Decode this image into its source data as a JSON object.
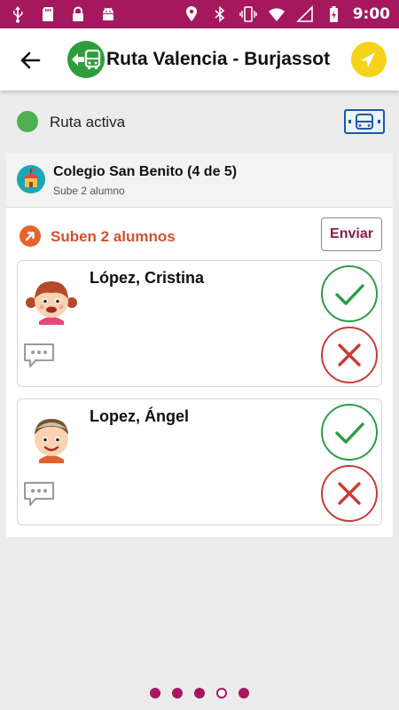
{
  "status_bar": {
    "time": "9:00",
    "color": "#a5185e",
    "left_icons": [
      "usb-icon",
      "sd-card-icon",
      "lock-icon",
      "android-icon"
    ],
    "right_icons": [
      "location-icon",
      "bluetooth-icon",
      "vibrate-icon",
      "wifi-icon",
      "signal-icon",
      "battery-charging-icon"
    ]
  },
  "app_bar": {
    "title": "Ruta Valencia - Burjassot",
    "back_icon": "arrow-back-icon",
    "logo_icon": "bus-route-icon",
    "action_icon": "navigation-icon",
    "logo_color": "#2e9e3a",
    "action_color": "#f6d31b"
  },
  "route_status": {
    "label": "Ruta activa",
    "indicator_color": "#4caf50",
    "card_icon": "bus-card-icon"
  },
  "stop": {
    "title": "Colegio San Benito (4 de 5)",
    "subtitle": "Sube 2 alumno",
    "icon": "school-icon"
  },
  "boarding": {
    "label": "Suben 2 alumnos",
    "icon": "arrow-up-right-icon",
    "send_label": "Enviar",
    "accent_color": "#d4512a"
  },
  "students": [
    {
      "name": "López, Cristina",
      "avatar": "girl-avatar-icon"
    },
    {
      "name": "Lopez, Ángel",
      "avatar": "boy-avatar-icon"
    }
  ],
  "pager": {
    "total": 5,
    "current": 4,
    "color": "#a5185e"
  }
}
